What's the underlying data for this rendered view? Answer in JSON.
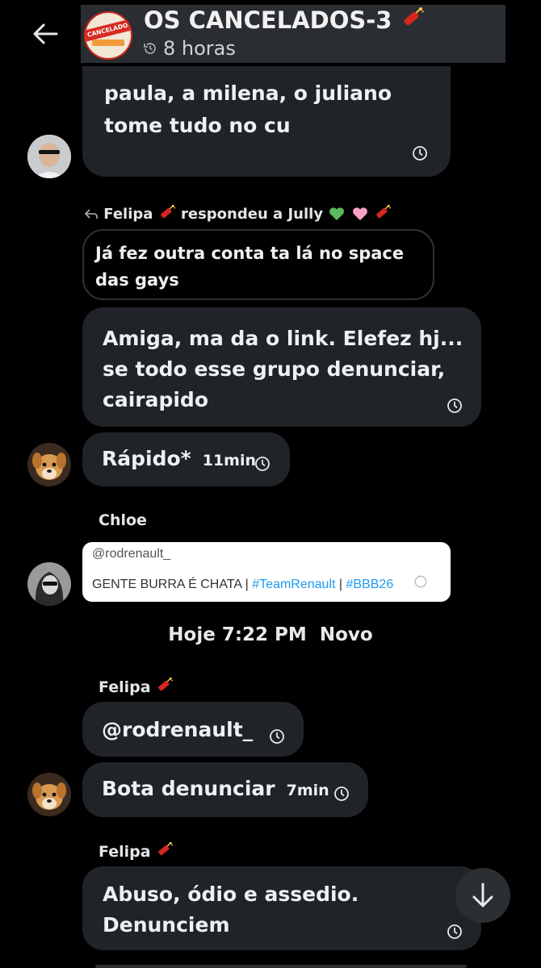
{
  "header": {
    "title": "OS CANCELADOS-3",
    "subtitle": "8 horas",
    "avatar_text": "CANCELADOS"
  },
  "messages": {
    "m1": {
      "line1": "paula, a milena, o juliano",
      "line2": "tome tudo no cu"
    },
    "reply_header": {
      "name": "Felipa",
      "action": "respondeu a",
      "target": "Jully"
    },
    "reply_quote": {
      "line1": "Já fez outra conta ta lá no space",
      "line2": "das gays"
    },
    "m2": {
      "line1": "Amiga, ma da o link. Elefez hj...",
      "line2": "se todo esse grupo denunciar,",
      "line3": "cairapido"
    },
    "m3": {
      "text": "Rápido*",
      "time": "11min"
    },
    "chloe_name": "Chloe",
    "tweet": {
      "handle": "@rodrenault_",
      "text": "GENTE BURRA É CHATA",
      "sep1": "|",
      "tag1": "#TeamRenault",
      "sep2": "|",
      "tag2": "#BBB26"
    },
    "divider": {
      "label": "Hoje 7:22 PM",
      "new_label": "Novo"
    },
    "felipa_name_1": "Felipa",
    "m4": {
      "text": "@rodrenault_"
    },
    "m5": {
      "text": "Bota denunciar",
      "time": "7min"
    },
    "felipa_name_2": "Felipa",
    "m6": {
      "line1": "Abuso, ódio e assedio.",
      "line2": "Denunciem"
    }
  },
  "colors": {
    "background": "#000000",
    "bubble": "#202327",
    "header_bar": "#2a2d31",
    "hashtag": "#1d9bf0",
    "green_heart": "#5cb85c",
    "pink_heart": "#f7a1c4"
  },
  "icons": [
    "back-arrow-icon",
    "history-icon",
    "firecracker-icon",
    "clock-icon",
    "reply-icon",
    "green-heart-icon",
    "pink-heart-icon",
    "scroll-down-arrow-icon"
  ]
}
